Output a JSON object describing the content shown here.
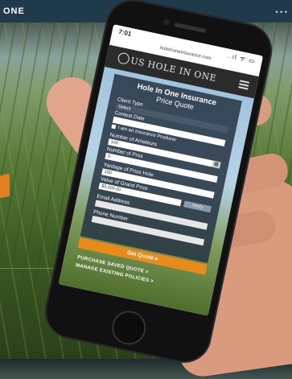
{
  "backdrop": {
    "site_fragment": "ONE",
    "dots": "• • •"
  },
  "status_bar": {
    "time": "7:01",
    "icons": "..ıl ᯤ ▭"
  },
  "browser": {
    "url": "holeinoneinsurance.com"
  },
  "header": {
    "logo_text": "US HOLE IN ONE"
  },
  "form": {
    "title": "Hole In One Insurance",
    "subtitle": "Price Quote",
    "client_type_label": "Client Type",
    "client_type_value": "Select",
    "contest_date_label": "Contest Date",
    "contest_date_value": "",
    "producer_checkbox_label": "I am an Insurance Producer",
    "number_of_amateurs_label": "Number of Amateurs",
    "number_of_amateurs_value": "100",
    "number_of_pros_label": "Number of Pros",
    "number_of_pros_value": "0",
    "yardage_label": "Yardage of Prize Hole",
    "yardage_value": "150",
    "prize_value_label": "Value of Grand Prize",
    "prize_value_value": "$5,000.00",
    "verify_label": "Verify",
    "email_label": "Email Address",
    "email_placeholder": "",
    "phone_label": "Phone Number",
    "phone_placeholder": "",
    "submit_label": "Get Quote ▸",
    "link_saved": "PURCHASE SAVED QUOTE >",
    "link_policies": "MANAGE EXISTING POLICIES >"
  },
  "colors": {
    "accent": "#e98b1a",
    "header_bg": "#2b2b2b",
    "card_bg": "#28374680"
  }
}
